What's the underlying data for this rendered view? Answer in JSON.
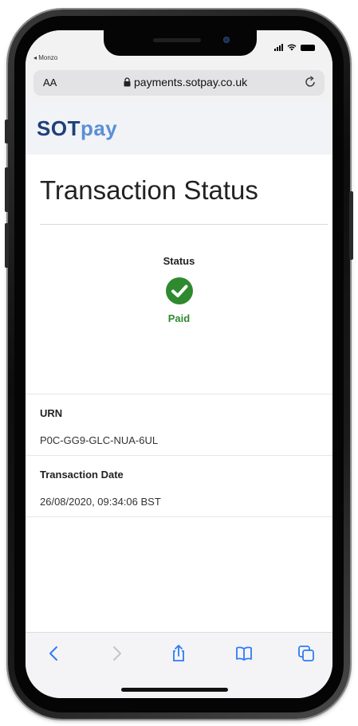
{
  "status_bar": {
    "back_app": "◂ Monzo"
  },
  "browser": {
    "text_size_label": "AA",
    "url": "payments.sotpay.co.uk"
  },
  "site": {
    "logo_part1": "SOT",
    "logo_part2": "pay"
  },
  "page": {
    "title": "Transaction Status",
    "status_label": "Status",
    "status_value": "Paid",
    "status_color": "#2f8a2f"
  },
  "details": [
    {
      "label": "URN",
      "value": "P0C-GG9-GLC-NUA-6UL"
    },
    {
      "label": "Transaction Date",
      "value": "26/08/2020, 09:34:06 BST"
    }
  ],
  "toolbar": {
    "icons": [
      "back-icon",
      "forward-icon",
      "share-icon",
      "bookmarks-icon",
      "tabs-icon"
    ],
    "accent": "#2f7bf5"
  }
}
